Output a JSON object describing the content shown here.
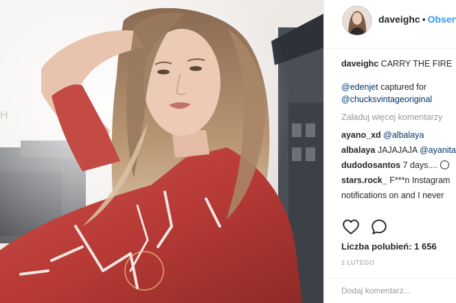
{
  "photo": {
    "partial_letter": "H"
  },
  "header": {
    "username": "daveighc",
    "separator": "•",
    "follow_label": "Obserwuj"
  },
  "caption": {
    "username": "daveighc",
    "text": "CARRY THE FIRE"
  },
  "tags": {
    "mention": "@edenjet",
    "text": " captured for",
    "hashtag_mention": "@chucksvintageoriginal"
  },
  "load_more_label": "Załaduj więcej komentarzy",
  "comments": [
    {
      "username": "ayano_xd",
      "text": "@albalaya"
    },
    {
      "username": "albalaya",
      "text": "JAJAJAJA",
      "mention": "@ayanitax"
    },
    {
      "username": "dudodosantos",
      "text": "7 days...."
    },
    {
      "username": "stars.rock_",
      "text": "F***n Instagram",
      "text_2": "notifications on and I never"
    }
  ],
  "likes_label": "Liczba polubień: 1 656",
  "date_label": "2 LUTEGO",
  "add_comment_placeholder": "Dodaj komentarz...",
  "colors": {
    "link": "#003569",
    "follow": "#3897f0",
    "shirt": "#b83a36"
  },
  "icons": {
    "like": "heart-icon",
    "comment": "comment-bubble-icon",
    "emoji": "emoji-icon"
  }
}
